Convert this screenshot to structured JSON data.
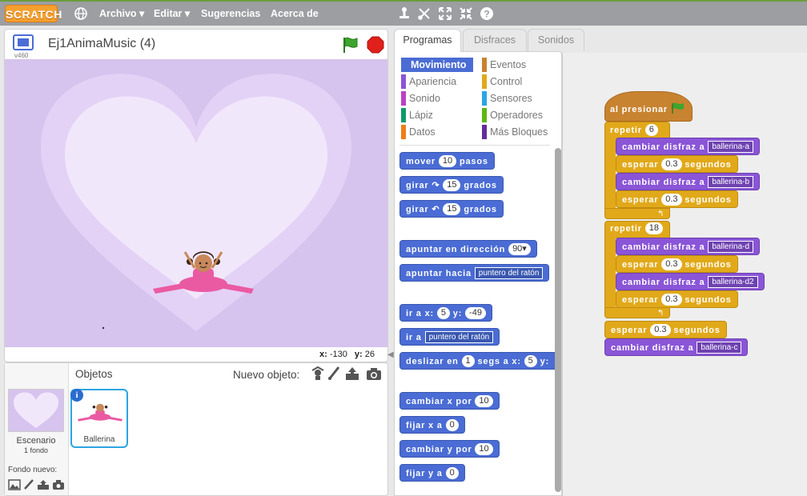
{
  "menu": {
    "logo": "SCRATCH",
    "items": [
      "Archivo ▾",
      "Editar ▾",
      "Sugerencias",
      "Acerca de"
    ]
  },
  "stage": {
    "title": "Ej1AnimaMusic (4)",
    "version": "v460",
    "coords_x_label": "x:",
    "coords_x": "-130",
    "coords_y_label": "y:",
    "coords_y": "26"
  },
  "sprites": {
    "header": "Objetos",
    "new_label": "Nuevo objeto:",
    "scene_label": "Escenario",
    "scene_sub": "1 fondo",
    "backdrop_label": "Fondo nuevo:",
    "sprite_name": "Ballerina"
  },
  "tabs": [
    "Programas",
    "Disfraces",
    "Sonidos"
  ],
  "categories": [
    {
      "label": "Movimiento",
      "color": "#4a6cd4"
    },
    {
      "label": "Eventos",
      "color": "#c88330"
    },
    {
      "label": "Apariencia",
      "color": "#8a55d7"
    },
    {
      "label": "Control",
      "color": "#e1a91a"
    },
    {
      "label": "Sonido",
      "color": "#bb42c3"
    },
    {
      "label": "Sensores",
      "color": "#2ca5e2"
    },
    {
      "label": "Lápiz",
      "color": "#0e9a6c"
    },
    {
      "label": "Operadores",
      "color": "#5cb712"
    },
    {
      "label": "Datos",
      "color": "#ee7d16"
    },
    {
      "label": "Más Bloques",
      "color": "#632d99"
    }
  ],
  "palette": {
    "move": {
      "a": "mover",
      "n": "10",
      "b": "pasos"
    },
    "turn_r": {
      "a": "girar",
      "n": "15",
      "b": "grados"
    },
    "turn_l": {
      "a": "girar",
      "n": "15",
      "b": "grados"
    },
    "point_dir": {
      "a": "apuntar en dirección",
      "n": "90▾"
    },
    "point_to": {
      "a": "apuntar hacia",
      "d": "puntero del ratón"
    },
    "goto_xy": {
      "a": "ir a x:",
      "x": "5",
      "b": "y:",
      "y": "-49"
    },
    "goto": {
      "a": "ir a",
      "d": "puntero del ratón"
    },
    "glide": {
      "a": "deslizar en",
      "n": "1",
      "b": "segs a x:",
      "x": "5",
      "c": "y:"
    },
    "change_x": {
      "a": "cambiar x por",
      "n": "10"
    },
    "set_x": {
      "a": "fijar x a",
      "n": "0"
    },
    "change_y": {
      "a": "cambiar y por",
      "n": "10"
    },
    "set_y": {
      "a": "fijar y a",
      "n": "0"
    }
  },
  "script": {
    "hat": "al presionar",
    "repeat1": {
      "label": "repetir",
      "n": "6"
    },
    "r1": [
      {
        "kind": "costume",
        "a": "cambiar disfraz a",
        "d": "ballerina-a"
      },
      {
        "kind": "wait",
        "a": "esperar",
        "n": "0.3",
        "b": "segundos"
      },
      {
        "kind": "costume",
        "a": "cambiar disfraz a",
        "d": "ballerina-b"
      },
      {
        "kind": "wait",
        "a": "esperar",
        "n": "0.3",
        "b": "segundos"
      }
    ],
    "repeat2": {
      "label": "repetir",
      "n": "18"
    },
    "r2": [
      {
        "kind": "costume",
        "a": "cambiar disfraz a",
        "d": "ballerina-d"
      },
      {
        "kind": "wait",
        "a": "esperar",
        "n": "0.3",
        "b": "segundos"
      },
      {
        "kind": "costume",
        "a": "cambiar disfraz a",
        "d": "ballerina-d2"
      },
      {
        "kind": "wait",
        "a": "esperar",
        "n": "0.3",
        "b": "segundos"
      }
    ],
    "wait_after": {
      "a": "esperar",
      "n": "0.3",
      "b": "segundos"
    },
    "final": {
      "a": "cambiar disfraz a",
      "d": "ballerina-c"
    }
  }
}
